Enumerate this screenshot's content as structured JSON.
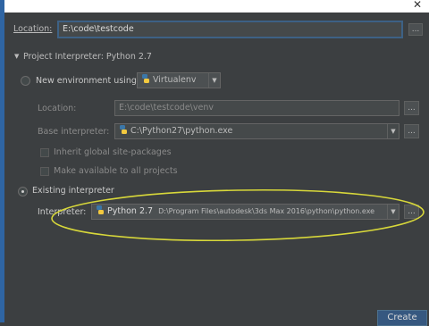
{
  "location": {
    "label": "Location:",
    "value": "E:\\code\\testcode"
  },
  "interpreter_section": {
    "title": "Project Interpreter: Python 2.7"
  },
  "new_env": {
    "label": "New environment using",
    "tool": "Virtualenv",
    "location_label": "Location:",
    "location_value": "E:\\code\\testcode\\venv",
    "base_label": "Base interpreter:",
    "base_value": "C:\\Python27\\python.exe",
    "inherit_label": "Inherit global site-packages",
    "available_label": "Make available to all projects"
  },
  "existing": {
    "label": "Existing interpreter",
    "interpreter_label": "Interpreter:",
    "interpreter_name": "Python 2.7",
    "interpreter_path": "D:\\Program Files\\autodesk\\3ds Max 2016\\python\\python.exe"
  },
  "buttons": {
    "browse": "...",
    "create": "Create"
  },
  "icons": {
    "python": "python-icon",
    "dropdown": "dropdown-arrow-icon",
    "collapse": "collapse-triangle-icon"
  },
  "colors": {
    "highlight_ellipse": "#d8d83a",
    "selection_border": "#3d6185",
    "sidebar_accent": "#2f65a3"
  }
}
